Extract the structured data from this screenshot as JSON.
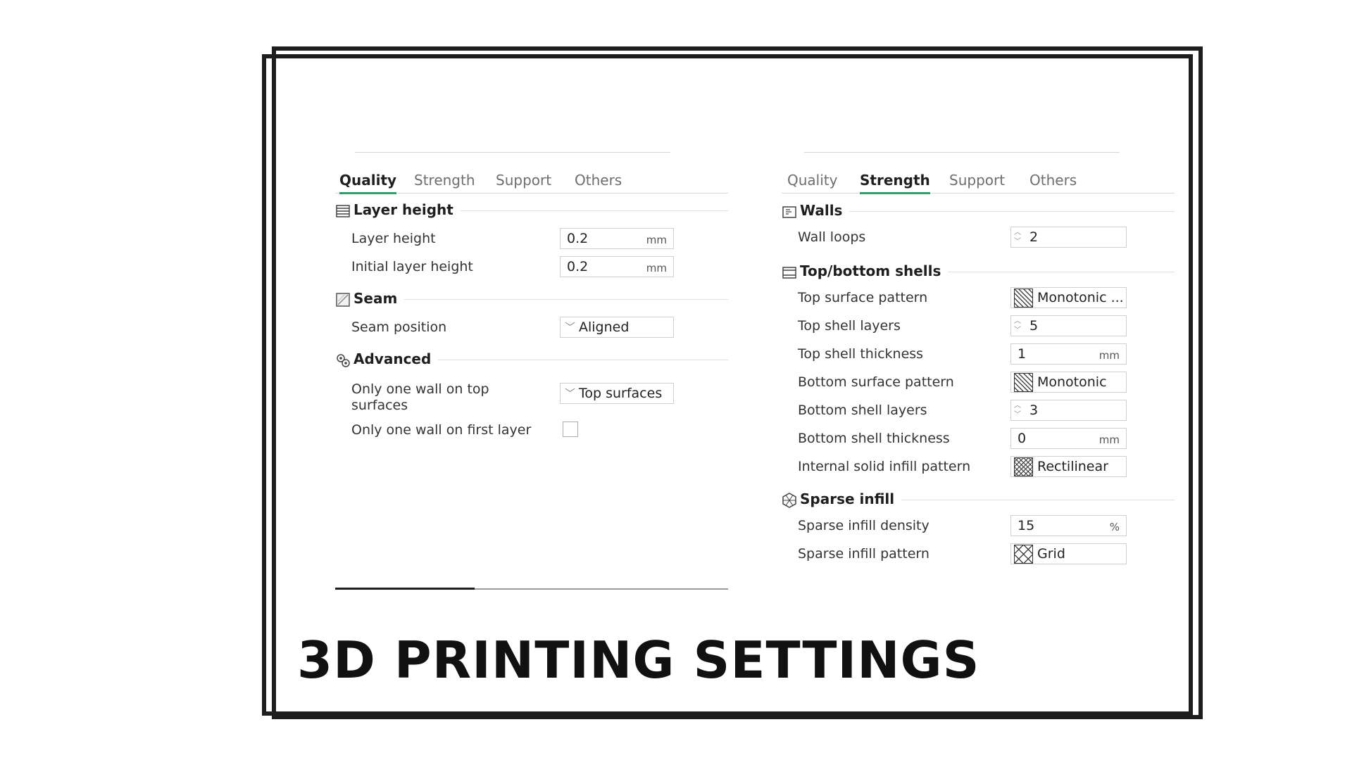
{
  "title": "3D PRINTING SETTINGS",
  "left_panel": {
    "tabs": [
      "Quality",
      "Strength",
      "Support",
      "Others"
    ],
    "active_tab": "Quality",
    "sections": {
      "layer_height": {
        "title": "Layer height",
        "icon": "layers-icon",
        "rows": [
          {
            "label": "Layer height",
            "value": "0.2",
            "unit": "mm"
          },
          {
            "label": "Initial layer height",
            "value": "0.2",
            "unit": "mm"
          }
        ]
      },
      "seam": {
        "title": "Seam",
        "icon": "seam-icon",
        "rows": [
          {
            "label": "Seam position",
            "value": "Aligned"
          }
        ]
      },
      "advanced": {
        "title": "Advanced",
        "icon": "advanced-gears-icon",
        "rows": [
          {
            "label": "Only one wall on top surfaces",
            "value": "Top surfaces"
          },
          {
            "label": "Only one wall on first layer",
            "checked": false
          }
        ]
      }
    }
  },
  "right_panel": {
    "tabs": [
      "Quality",
      "Strength",
      "Support",
      "Others"
    ],
    "active_tab": "Strength",
    "sections": {
      "walls": {
        "title": "Walls",
        "icon": "walls-icon",
        "rows": [
          {
            "label": "Wall loops",
            "value": "2"
          }
        ]
      },
      "shells": {
        "title": "Top/bottom shells",
        "icon": "shells-icon",
        "rows": [
          {
            "label": "Top surface pattern",
            "value": "Monotonic ...",
            "pattern_icon": "monotonic-pattern-icon"
          },
          {
            "label": "Top shell layers",
            "value": "5"
          },
          {
            "label": "Top shell thickness",
            "value": "1",
            "unit": "mm"
          },
          {
            "label": "Bottom surface pattern",
            "value": "Monotonic",
            "pattern_icon": "monotonic-pattern-icon"
          },
          {
            "label": "Bottom shell layers",
            "value": "3"
          },
          {
            "label": "Bottom shell thickness",
            "value": "0",
            "unit": "mm"
          },
          {
            "label": "Internal solid infill pattern",
            "value": "Rectilinear",
            "pattern_icon": "rectilinear-pattern-icon"
          }
        ]
      },
      "sparse": {
        "title": "Sparse infill",
        "icon": "sparse-infill-icon",
        "rows": [
          {
            "label": "Sparse infill density",
            "value": "15",
            "unit": "%"
          },
          {
            "label": "Sparse infill pattern",
            "value": "Grid",
            "pattern_icon": "grid-pattern-icon"
          }
        ]
      }
    }
  },
  "colors": {
    "accent": "#2e9e6a",
    "frame": "#1e1e1e"
  }
}
